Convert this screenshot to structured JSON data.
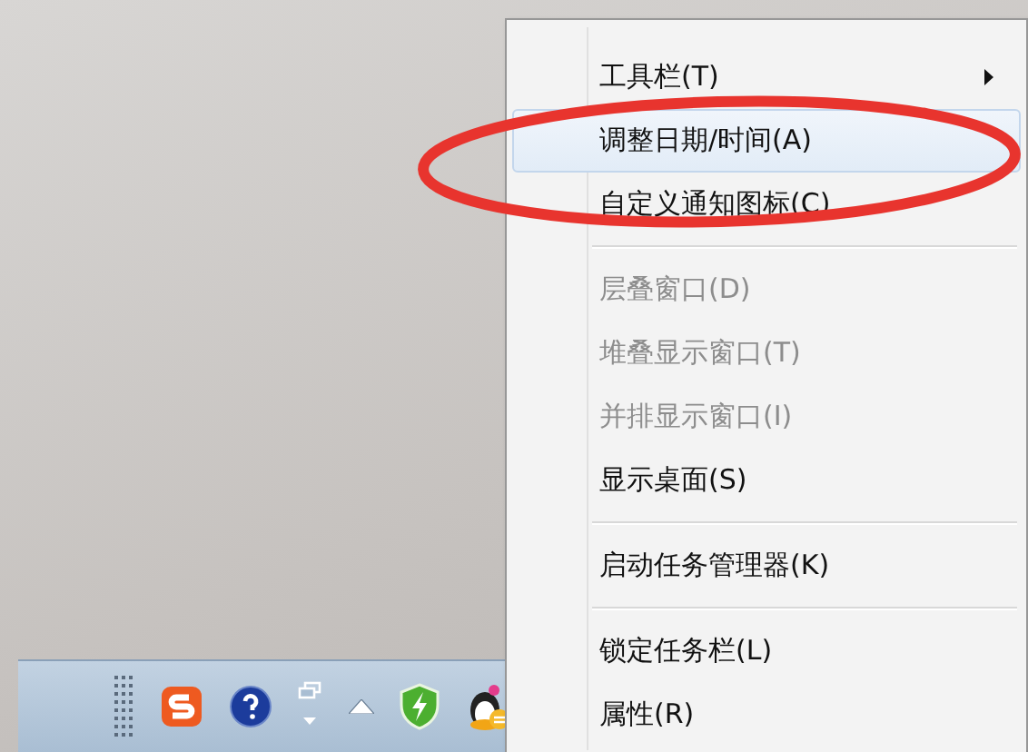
{
  "taskbar": {
    "icons": [
      {
        "kind": "grip"
      },
      {
        "kind": "s-logo"
      },
      {
        "kind": "help"
      },
      {
        "kind": "window-dropdown"
      },
      {
        "kind": "up-arrow"
      },
      {
        "kind": "shield"
      },
      {
        "kind": "penguin"
      }
    ]
  },
  "context_menu": {
    "items": [
      {
        "kind": "item",
        "label": "工具栏(T)",
        "disabled": false,
        "selected": false,
        "submenu": true
      },
      {
        "kind": "item",
        "label": "调整日期/时间(A)",
        "disabled": false,
        "selected": true,
        "submenu": false
      },
      {
        "kind": "item",
        "label": "自定义通知图标(C)",
        "disabled": false,
        "selected": false,
        "submenu": false
      },
      {
        "kind": "separator"
      },
      {
        "kind": "item",
        "label": "层叠窗口(D)",
        "disabled": true,
        "selected": false,
        "submenu": false
      },
      {
        "kind": "item",
        "label": "堆叠显示窗口(T)",
        "disabled": true,
        "selected": false,
        "submenu": false
      },
      {
        "kind": "item",
        "label": "并排显示窗口(I)",
        "disabled": true,
        "selected": false,
        "submenu": false
      },
      {
        "kind": "item",
        "label": "显示桌面(S)",
        "disabled": false,
        "selected": false,
        "submenu": false
      },
      {
        "kind": "separator"
      },
      {
        "kind": "item",
        "label": "启动任务管理器(K)",
        "disabled": false,
        "selected": false,
        "submenu": false
      },
      {
        "kind": "separator"
      },
      {
        "kind": "item",
        "label": "锁定任务栏(L)",
        "disabled": false,
        "selected": false,
        "submenu": false
      },
      {
        "kind": "item",
        "label": "属性(R)",
        "disabled": false,
        "selected": false,
        "submenu": false
      }
    ]
  },
  "annotation": {
    "kind": "ellipse"
  }
}
